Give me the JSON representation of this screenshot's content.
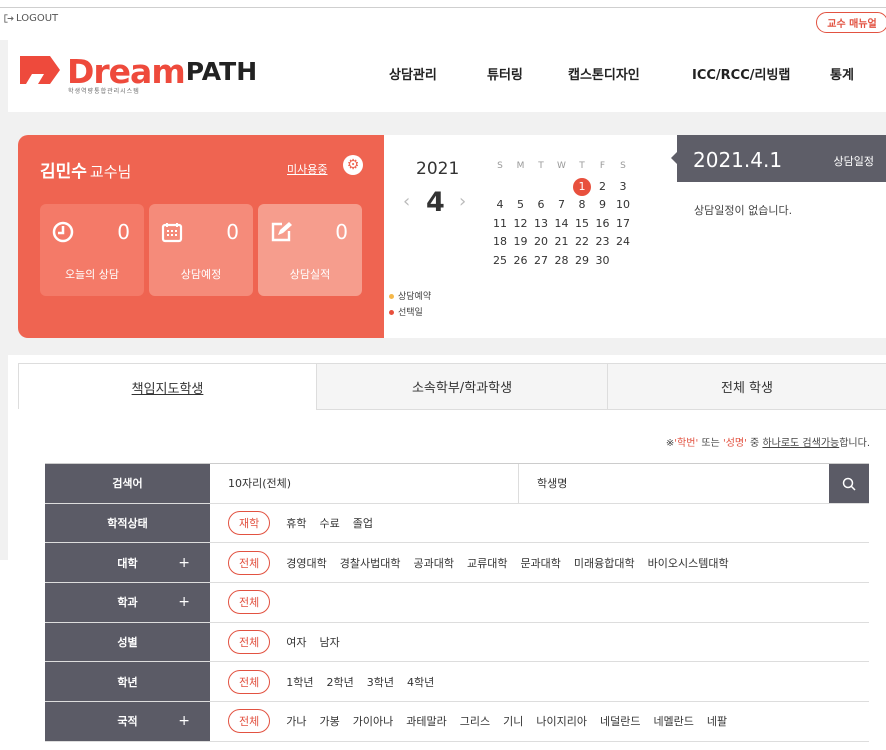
{
  "topbar": {
    "logout": "LOGOUT",
    "manual": "교수 매뉴얼"
  },
  "logo": {
    "word1": "Dream",
    "word2": "PATH",
    "tagline": "학생역량통합관리시스템"
  },
  "nav": [
    "상담관리",
    "튜터링",
    "캡스톤디자인",
    "ICC/RCC/리빙랩",
    "통계"
  ],
  "profile": {
    "name": "김민수",
    "suffix": "교수님",
    "status_link": "미사용중"
  },
  "stats": [
    {
      "label": "오늘의 상담",
      "value": "0",
      "icon": "clock-icon"
    },
    {
      "label": "상담예정",
      "value": "0",
      "icon": "calendar-icon"
    },
    {
      "label": "상담실적",
      "value": "0",
      "icon": "edit-icon"
    }
  ],
  "calendar": {
    "year": "2021",
    "month": "4",
    "weekdays": [
      "S",
      "M",
      "T",
      "W",
      "T",
      "F",
      "S"
    ],
    "weeks": [
      [
        "",
        "",
        "",
        "",
        "1",
        "2",
        "3"
      ],
      [
        "4",
        "5",
        "6",
        "7",
        "8",
        "9",
        "10"
      ],
      [
        "11",
        "12",
        "13",
        "14",
        "15",
        "16",
        "17"
      ],
      [
        "18",
        "19",
        "20",
        "21",
        "22",
        "23",
        "24"
      ],
      [
        "25",
        "26",
        "27",
        "28",
        "29",
        "30",
        ""
      ]
    ],
    "selected_day": "1",
    "legend": [
      {
        "label": "상담예약",
        "color": "#f5b84a"
      },
      {
        "label": "선택일",
        "color": "#e8503d"
      }
    ]
  },
  "schedule": {
    "date": "2021.4.1",
    "title": "상담일정",
    "empty": "상담일정이 없습니다."
  },
  "tabs": [
    "책임지도학생",
    "소속학부/학과학생",
    "전체 학생"
  ],
  "hint": {
    "prefix": "※",
    "term1": "'학번'",
    "mid1": " 또는 ",
    "term2": "'성명'",
    "mid2": " 중 ",
    "link": "하나로도 검색가능",
    "suffix": "합니다."
  },
  "search": {
    "keyword_label": "검색어",
    "keyword_select": "10자리(전체)",
    "name_placeholder": "학생명",
    "rows": [
      {
        "label": "학적상태",
        "expand": false,
        "active": "재학",
        "options": [
          "휴학",
          "수료",
          "졸업"
        ]
      },
      {
        "label": "대학",
        "expand": true,
        "active": "전체",
        "options": [
          "경영대학",
          "경찰사법대학",
          "공과대학",
          "교류대학",
          "문과대학",
          "미래융합대학",
          "바이오시스템대학"
        ]
      },
      {
        "label": "학과",
        "expand": true,
        "active": "전체",
        "options": []
      },
      {
        "label": "성별",
        "expand": false,
        "active": "전체",
        "options": [
          "여자",
          "남자"
        ]
      },
      {
        "label": "학년",
        "expand": false,
        "active": "전체",
        "options": [
          "1학년",
          "2학년",
          "3학년",
          "4학년"
        ]
      },
      {
        "label": "국적",
        "expand": true,
        "active": "전체",
        "options": [
          "가나",
          "가봉",
          "가이아나",
          "과테말라",
          "그리스",
          "기니",
          "나이지리아",
          "네덜란드",
          "네멜란드",
          "네팔"
        ]
      }
    ],
    "plus_symbol": "+"
  },
  "colors": {
    "accent": "#ef6451",
    "dark": "#5b5b66"
  }
}
